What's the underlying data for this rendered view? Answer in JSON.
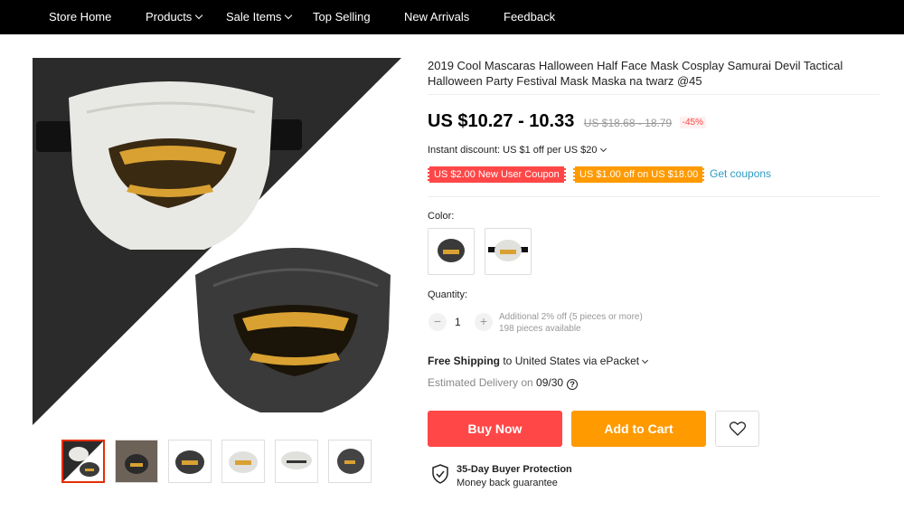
{
  "nav": {
    "items": [
      {
        "label": "Store Home"
      },
      {
        "label": "Products"
      },
      {
        "label": "Sale Items"
      },
      {
        "label": "Top Selling"
      },
      {
        "label": "New Arrivals"
      },
      {
        "label": "Feedback"
      }
    ]
  },
  "gallery": {
    "thumbnails": [
      "white-and-black-mask",
      "black-mask-worn",
      "black-mask",
      "white-mask",
      "white-mask-side",
      "black-mask-side"
    ]
  },
  "product": {
    "title": "2019 Cool Mascaras Halloween Half Face Mask Cosplay Samurai Devil Tactical Halloween Party Festival Mask Maska na twarz @45",
    "price": "US $10.27 - 10.33",
    "old_price": "US $18.68 - 18.79",
    "discount": "-45%",
    "instant_discount": "Instant discount: US $1 off per US $20",
    "coupon_new_user": "US $2.00 New User Coupon",
    "coupon_off": "US $1.00 off on US $18.00",
    "get_coupons": "Get coupons",
    "color_label": "Color:",
    "quantity_label": "Quantity:",
    "quantity": {
      "minus": "−",
      "value": "1",
      "plus": "+"
    },
    "quantity_note_1": "Additional 2% off (5 pieces or more)",
    "quantity_note_2": "198 pieces available",
    "shipping_bold": "Free Shipping",
    "shipping_rest": " to United States via ePacket",
    "delivery_label": "Estimated Delivery on ",
    "delivery_date": "09/30",
    "buy_now": "Buy Now",
    "add_to_cart": "Add to Cart",
    "protection_title": "35-Day Buyer Protection",
    "protection_sub": "Money back guarantee"
  },
  "colors": {
    "nav_bg": "#000000",
    "buy_now": "#ff4747",
    "add_to_cart": "#ff9a00",
    "link": "#2e9cc3"
  }
}
